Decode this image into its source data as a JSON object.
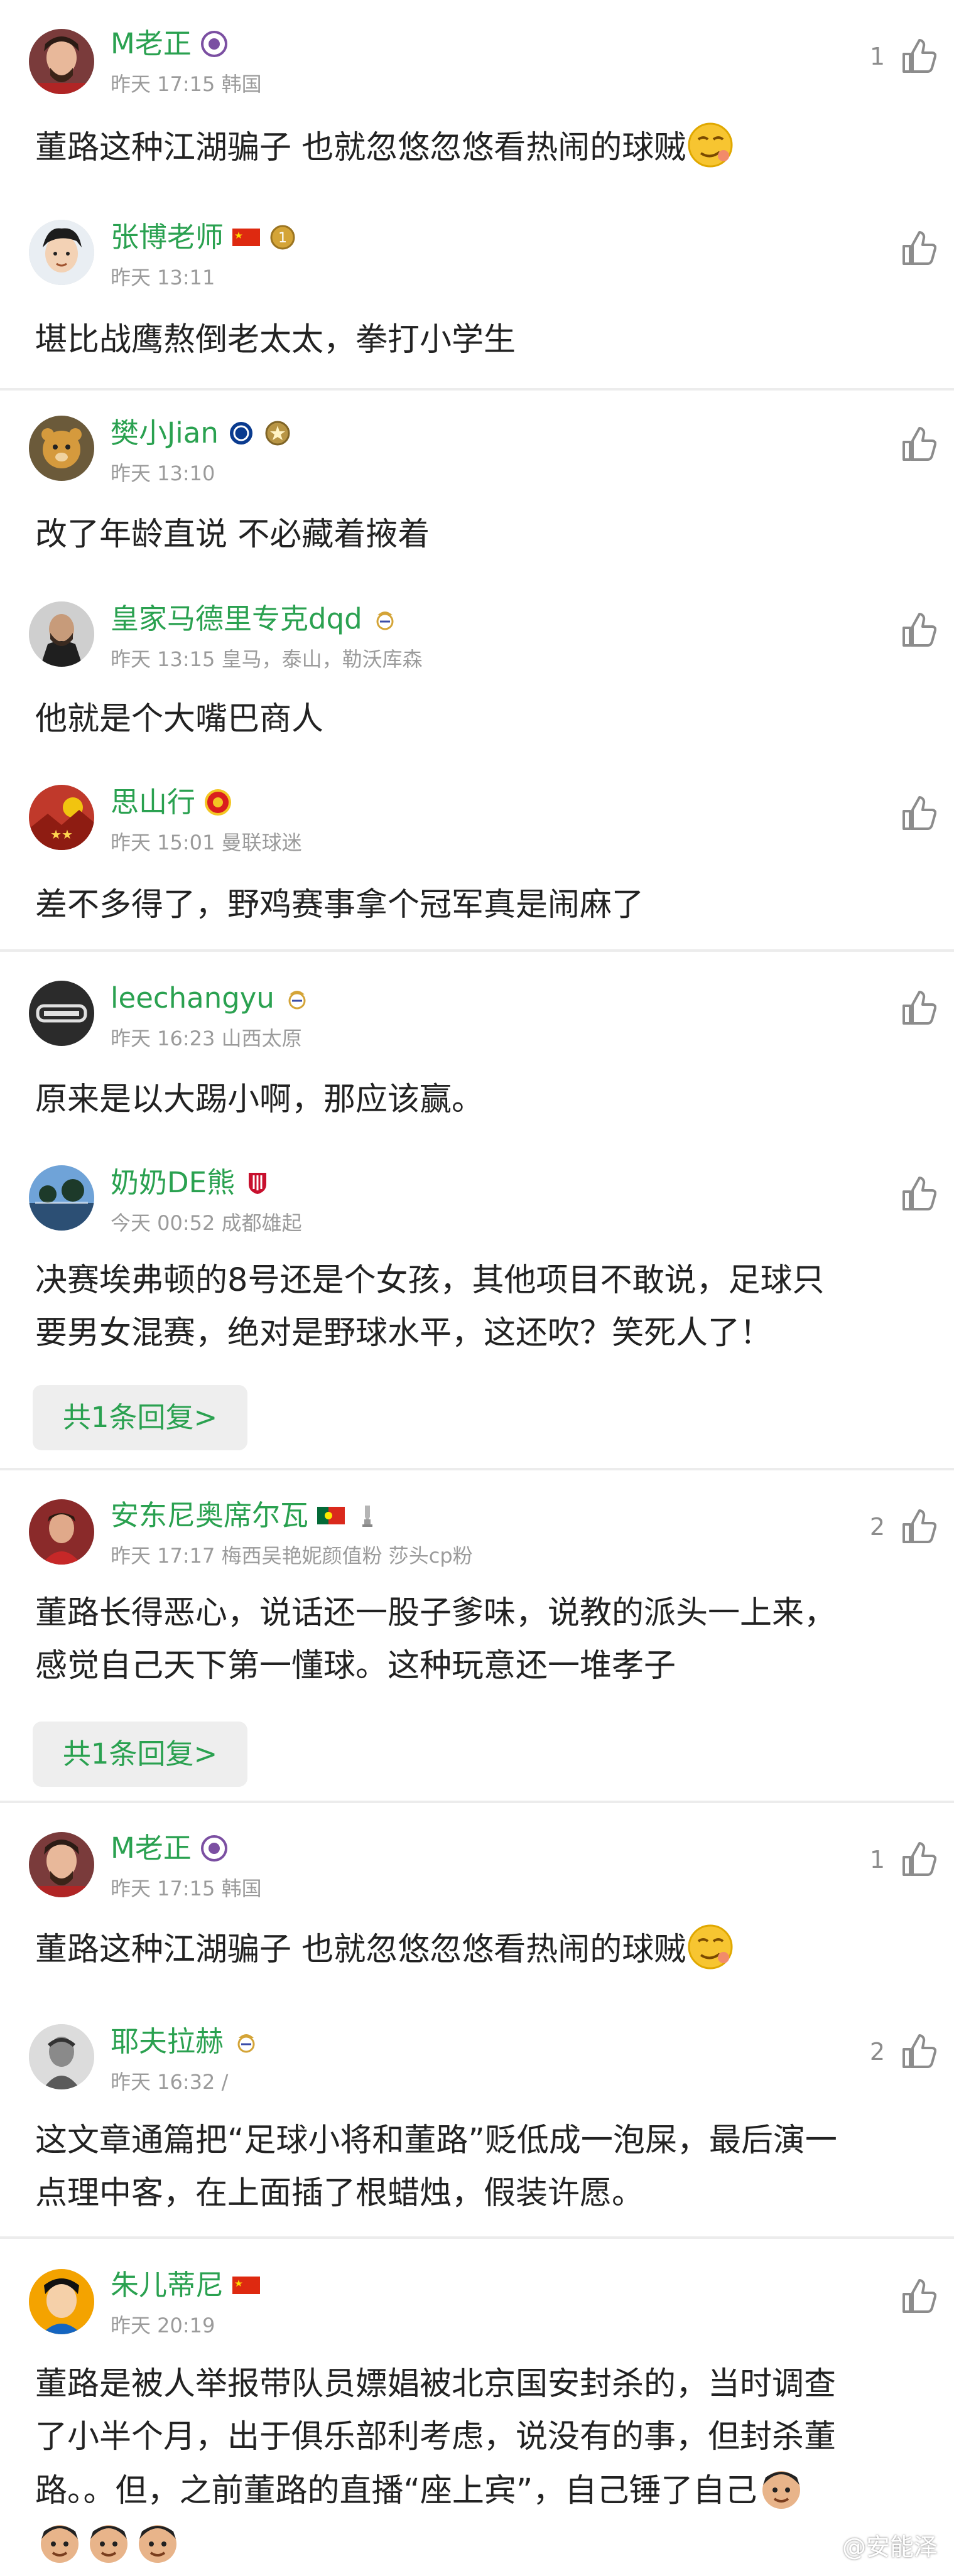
{
  "colors": {
    "username": "#2aa150",
    "meta": "#9b9b9b",
    "text": "#222222",
    "divider": "#ececec"
  },
  "comments": [
    {
      "username": "M老正",
      "meta": "昨天 17:15 韩国",
      "likes": "1",
      "text": "董路这种江湖骗子 也就忽悠忽悠看热闹的球贼"
    },
    {
      "username": "张博老师",
      "meta": "昨天 13:11",
      "likes": "",
      "text": "堪比战鹰熬倒老太太，拳打小学生"
    },
    {
      "username": "樊小Jian",
      "meta": "昨天 13:10",
      "likes": "",
      "text": "改了年龄直说 不必藏着掖着"
    },
    {
      "username": "皇家马德里专克dqd",
      "meta": "昨天 13:15 皇马，泰山，勒沃库森",
      "likes": "",
      "text": "他就是个大嘴巴商人"
    },
    {
      "username": "思山行",
      "meta": "昨天 15:01 曼联球迷",
      "likes": "",
      "text": "差不多得了，野鸡赛事拿个冠军真是闹麻了"
    },
    {
      "username": "leechangyu",
      "meta": "昨天 16:23 山西太原",
      "likes": "",
      "text": "原来是以大踢小啊，那应该赢。"
    },
    {
      "username": "奶奶DE熊",
      "meta": "今天 00:52 成都雄起",
      "likes": "",
      "text_line1": "决赛埃弗顿的8号还是个女孩，其他项目不敢说，足球只",
      "text_line2": "要男女混赛，绝对是野球水平，这还吹？笑死人了！",
      "reply_label": "共1条回复>"
    },
    {
      "username": "安东尼奥席尔瓦",
      "meta": "昨天 17:17 梅西吴艳妮颜值粉 莎头cp粉",
      "likes": "2",
      "text_line1": "董路长得恶心，说话还一股子爹味，说教的派头一上来，",
      "text_line2": "感觉自己天下第一懂球。这种玩意还一堆孝子",
      "reply_label": "共1条回复>"
    },
    {
      "username": "M老正",
      "meta": "昨天 17:15 韩国",
      "likes": "1",
      "text": "董路这种江湖骗子 也就忽悠忽悠看热闹的球贼"
    },
    {
      "username": "耶夫拉赫",
      "meta": "昨天 16:32 /",
      "likes": "2",
      "text_line1": "这文章通篇把“足球小将和董路”贬低成一泡屎，最后演一",
      "text_line2": "点理中客，在上面插了根蜡烛，假装许愿。"
    },
    {
      "username": "朱儿蒂尼",
      "meta": "昨天 20:19",
      "likes": "",
      "text_line1": "董路是被人举报带队员嫖娼被北京国安封杀的，当时调查",
      "text_line2": "了小半个月，出于俱乐部利考虑，说没有的事，但封杀董",
      "text_line3": "路。。但，之前董路的直播“座上宾”，自己锤了自己"
    }
  ],
  "watermark": "@安能泽"
}
